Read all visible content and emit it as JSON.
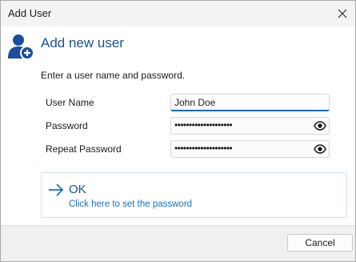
{
  "window": {
    "title": "Add User"
  },
  "header": {
    "heading": "Add new user",
    "icon": "user-add-icon"
  },
  "instruction": "Enter a user name and password.",
  "form": {
    "user_name": {
      "label": "User Name",
      "value": "John Doe"
    },
    "password": {
      "label": "Password",
      "value": "••••••••••••••••••••"
    },
    "repeat_password": {
      "label": "Repeat Password",
      "value": "••••••••••••••••••••"
    }
  },
  "command_link": {
    "title": "OK",
    "subtitle": "Click here to set the password",
    "icon": "arrow-right-icon"
  },
  "footer": {
    "cancel_label": "Cancel"
  },
  "colors": {
    "accent": "#1b4e9c",
    "link": "#1b6fc0",
    "focus_underline": "#0067c0"
  }
}
